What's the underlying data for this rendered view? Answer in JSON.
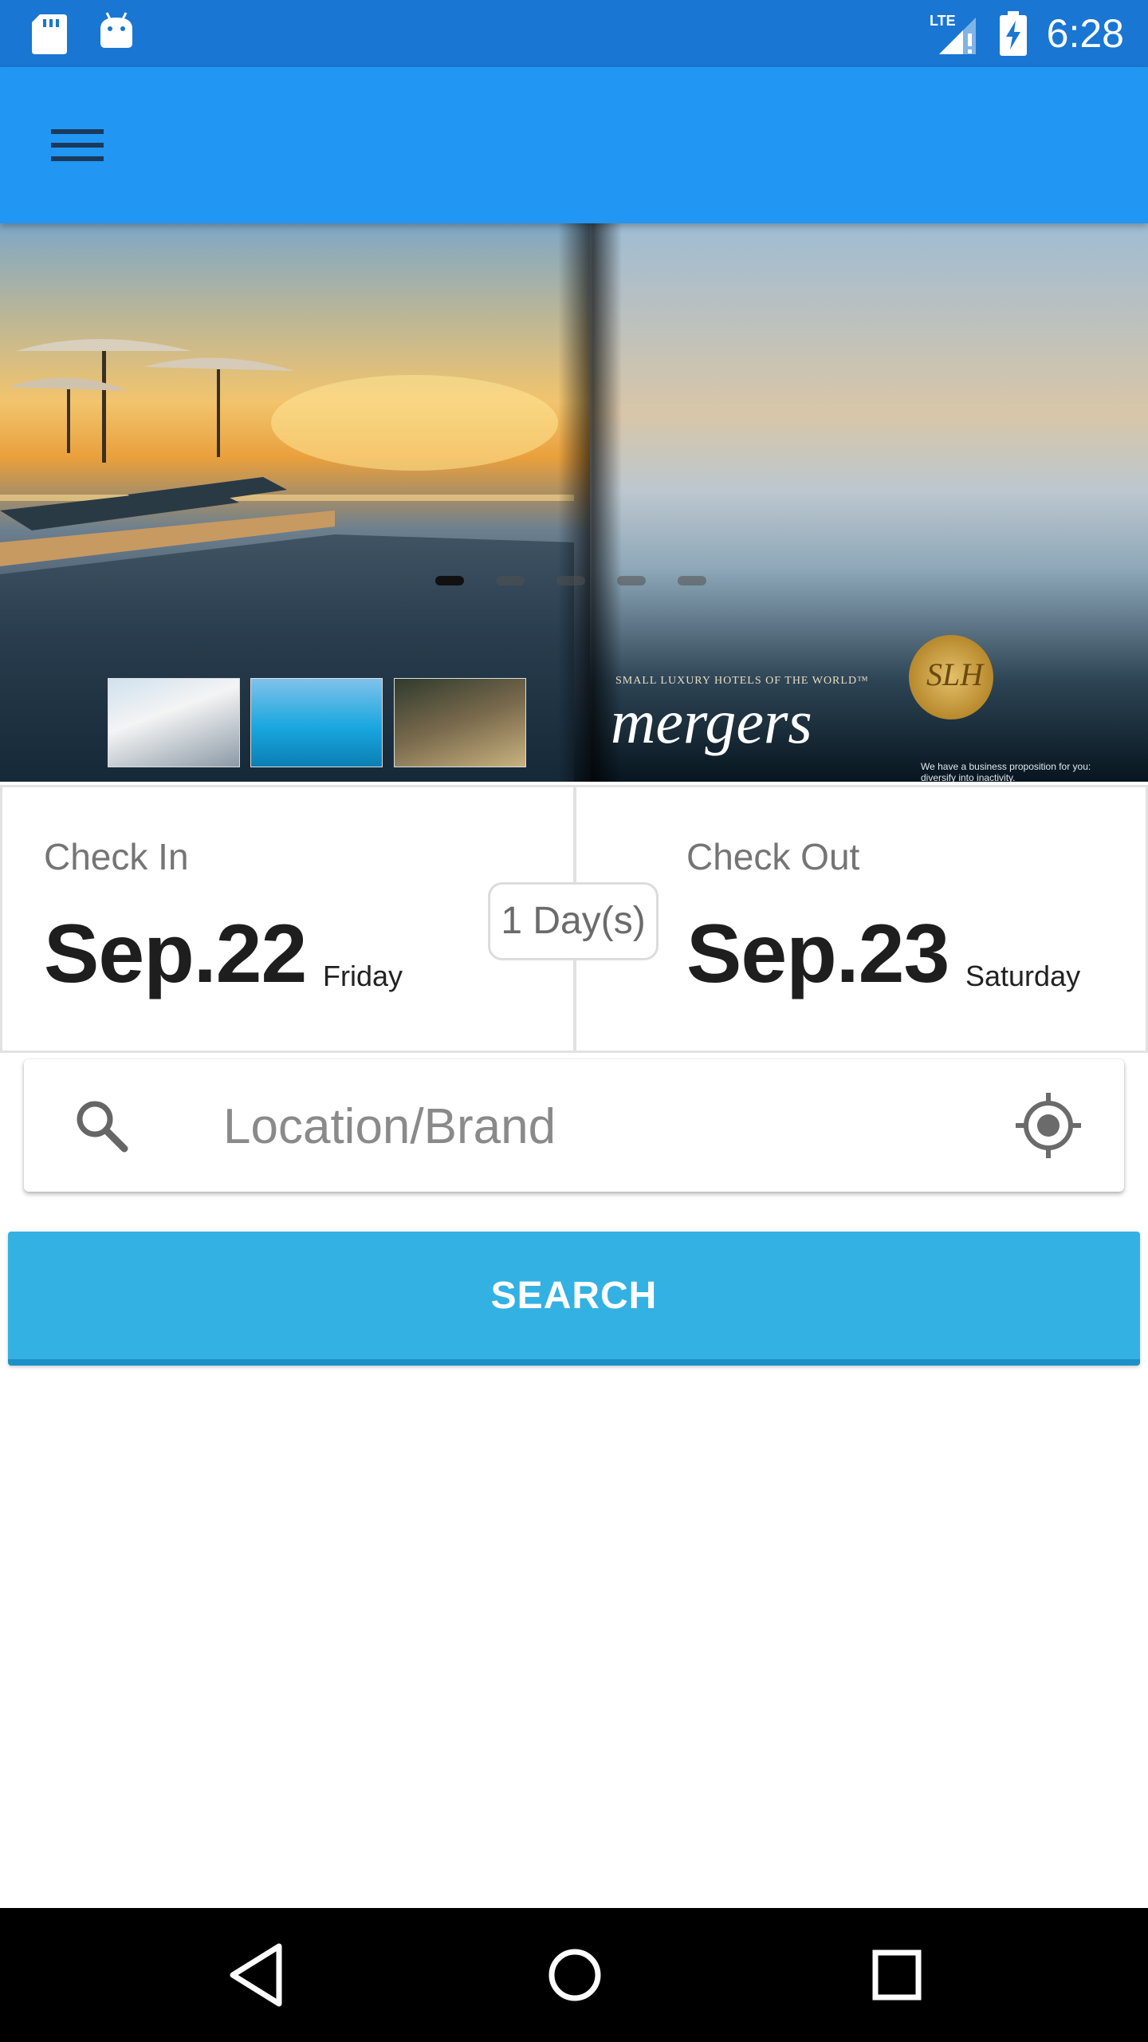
{
  "status_bar": {
    "time": "6:28",
    "network": "LTE",
    "icons": [
      "sd-card-icon",
      "android-icon",
      "signal-icon",
      "battery-charging-icon"
    ]
  },
  "app_bar": {
    "menu_icon": "hamburger-menu-icon",
    "color": "#2196f3"
  },
  "banner": {
    "ad_tagline": "SMALL LUXURY HOTELS OF THE WORLD™",
    "ad_title": "mergers",
    "ad_seal": "SLH",
    "ad_small_text": "We have a business proposition for you: diversify into inactivity.",
    "slide_count": 5,
    "active_slide": 1
  },
  "check_in": {
    "label": "Check In",
    "date": "Sep.22",
    "weekday": "Friday"
  },
  "check_out": {
    "label": "Check Out",
    "date": "Sep.23",
    "weekday": "Saturday"
  },
  "nights": "1 Day(s)",
  "search": {
    "placeholder": "Location/Brand",
    "value": "",
    "icon": "search-icon",
    "locate_icon": "my-location-icon"
  },
  "search_button_label": "SEARCH",
  "colors": {
    "status_bar": "#1976d2",
    "app_bar": "#2196f3",
    "search_button": "#33b1e3"
  },
  "nav_bar": {
    "buttons": [
      "back-icon",
      "home-icon",
      "recents-icon"
    ]
  }
}
